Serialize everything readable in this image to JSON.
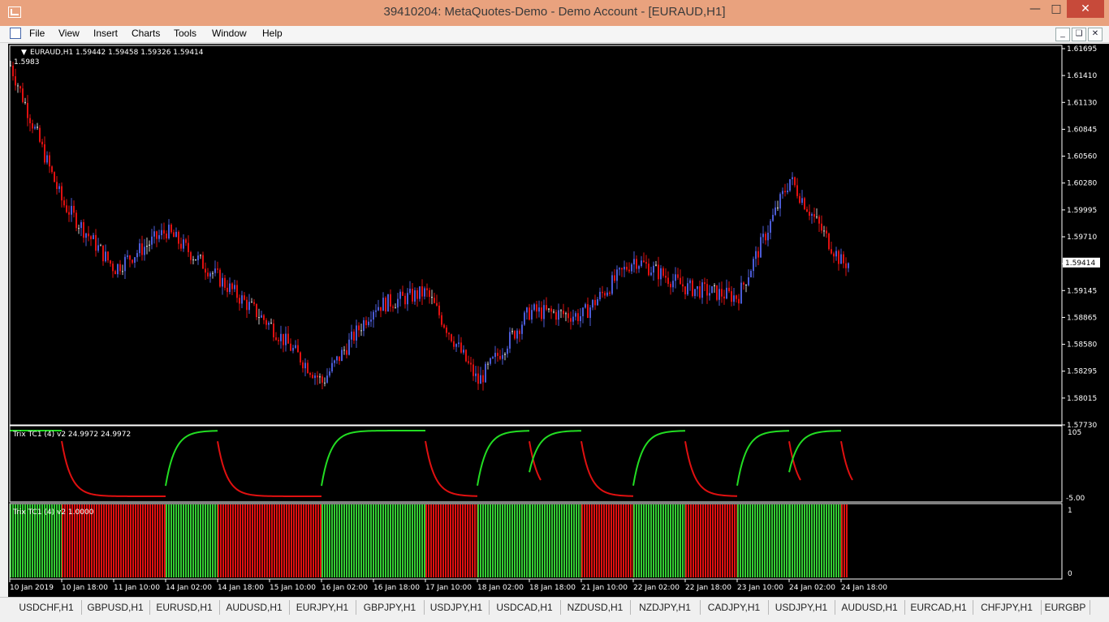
{
  "window": {
    "title": "39410204: MetaQuotes-Demo - Demo Account - [EURAUD,H1]"
  },
  "menu": [
    "File",
    "View",
    "Insert",
    "Charts",
    "Tools",
    "Window",
    "Help"
  ],
  "chart": {
    "header": "EURAUD,H1  1.59442 1.59458 1.59326 1.59414",
    "sub_header": "1.5983",
    "price_labels": [
      "1.61695",
      "1.61410",
      "1.61130",
      "1.60845",
      "1.60560",
      "1.60280",
      "1.59995",
      "1.59710",
      "1.59425",
      "1.59145",
      "1.58865",
      "1.58580",
      "1.58295",
      "1.58015",
      "1.57730"
    ],
    "current_price": "1.59414",
    "colors": {
      "bull": "#4b5bd6",
      "bear": "#e01010",
      "doji": "#c8c8c8",
      "up_line": "#22dd22",
      "down_line": "#e01010",
      "green_bar": "#33cc33",
      "red_bar": "#e01010"
    }
  },
  "indicator1": {
    "label": "Trix TC1 (4) v2 24.9972 24.9972",
    "scale_top": "105",
    "scale_bottom": "-5.00"
  },
  "indicator2": {
    "label": "Trix TC1 (4) v2 1.0000",
    "scale_top": "1",
    "scale_bottom": "0"
  },
  "time_labels": [
    "10 Jan 2019",
    "10 Jan 18:00",
    "11 Jan 10:00",
    "14 Jan 02:00",
    "14 Jan 18:00",
    "15 Jan 10:00",
    "16 Jan 02:00",
    "16 Jan 18:00",
    "17 Jan 10:00",
    "18 Jan 02:00",
    "18 Jan 18:00",
    "21 Jan 10:00",
    "22 Jan 02:00",
    "22 Jan 18:00",
    "23 Jan 10:00",
    "24 Jan 02:00",
    "24 Jan 18:00"
  ],
  "tabs": [
    "USDCHF,H1",
    "GBPUSD,H1",
    "EURUSD,H1",
    "AUDUSD,H1",
    "EURJPY,H1",
    "GBPJPY,H1",
    "USDJPY,H1",
    "USDCAD,H1",
    "NZDUSD,H1",
    "NZDJPY,H1",
    "CADJPY,H1",
    "USDJPY,H1",
    "AUDUSD,H1",
    "EURCAD,H1",
    "CHFJPY,H1",
    "EURGBP"
  ],
  "chart_data": {
    "type": "candlestick",
    "symbol": "EURAUD",
    "timeframe": "H1",
    "ylim": [
      1.5773,
      1.61695
    ],
    "segments": [
      {
        "from": "10 Jan 2019",
        "close": 1.615
      },
      {
        "from": "10 Jan 18:00",
        "close": 1.6005
      },
      {
        "from": "11 Jan 10:00",
        "close": 1.5935
      },
      {
        "from": "14 Jan 02:00",
        "close": 1.5975
      },
      {
        "from": "14 Jan 18:00",
        "close": 1.5925
      },
      {
        "from": "15 Jan 10:00",
        "close": 1.5875
      },
      {
        "from": "16 Jan 02:00",
        "close": 1.5815
      },
      {
        "from": "16 Jan 18:00",
        "close": 1.5895
      },
      {
        "from": "17 Jan 10:00",
        "close": 1.591
      },
      {
        "from": "18 Jan 02:00",
        "close": 1.5815
      },
      {
        "from": "18 Jan 18:00",
        "close": 1.589
      },
      {
        "from": "21 Jan 10:00",
        "close": 1.5885
      },
      {
        "from": "22 Jan 02:00",
        "close": 1.5945
      },
      {
        "from": "22 Jan 18:00",
        "close": 1.5915
      },
      {
        "from": "23 Jan 10:00",
        "close": 1.5905
      },
      {
        "from": "24 Jan 02:00",
        "close": 1.603
      },
      {
        "from": "24 Jan 18:00",
        "close": 1.5941
      }
    ],
    "trix_state": [
      {
        "state": "up",
        "from": "10 Jan 2019",
        "to": "10 Jan 18:00"
      },
      {
        "state": "down",
        "from": "10 Jan 18:00",
        "to": "14 Jan 02:00"
      },
      {
        "state": "up",
        "from": "14 Jan 02:00",
        "to": "14 Jan 18:00"
      },
      {
        "state": "down",
        "from": "14 Jan 18:00",
        "to": "16 Jan 02:00"
      },
      {
        "state": "up",
        "from": "16 Jan 02:00",
        "to": "17 Jan 10:00"
      },
      {
        "state": "down",
        "from": "17 Jan 10:00",
        "to": "18 Jan 02:00"
      },
      {
        "state": "up",
        "from": "18 Jan 02:00",
        "to": "18 Jan 18:00"
      },
      {
        "state": "down",
        "from": "18 Jan 18:00",
        "to": "18 Jan 18:00"
      },
      {
        "state": "up",
        "from": "18 Jan 18:00",
        "to": "21 Jan 10:00"
      },
      {
        "state": "down",
        "from": "21 Jan 10:00",
        "to": "22 Jan 02:00"
      },
      {
        "state": "up",
        "from": "22 Jan 02:00",
        "to": "22 Jan 18:00"
      },
      {
        "state": "down",
        "from": "22 Jan 18:00",
        "to": "23 Jan 10:00"
      },
      {
        "state": "up",
        "from": "23 Jan 10:00",
        "to": "24 Jan 02:00"
      },
      {
        "state": "down",
        "from": "24 Jan 02:00",
        "to": "24 Jan 02:00"
      },
      {
        "state": "up",
        "from": "24 Jan 02:00",
        "to": "24 Jan 18:00"
      },
      {
        "state": "down",
        "from": "24 Jan 18:00",
        "to": "24 Jan 18:00"
      }
    ]
  }
}
